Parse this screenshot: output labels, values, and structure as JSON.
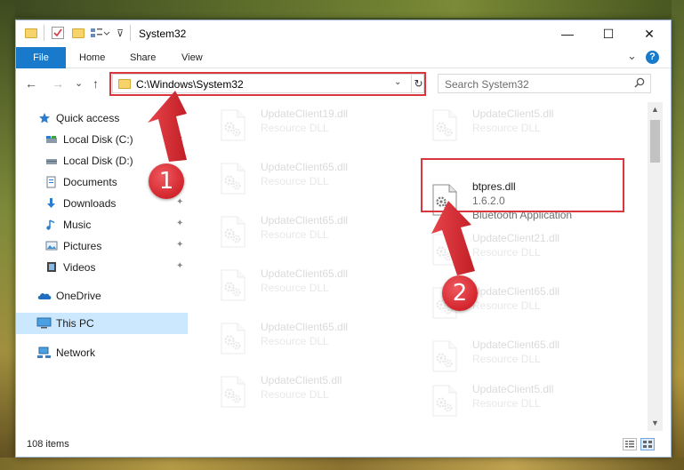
{
  "window": {
    "title": "System32",
    "min_glyph": "—",
    "max_glyph": "☐",
    "close_glyph": "✕"
  },
  "ribbon": {
    "tabs": [
      "File",
      "Home",
      "Share",
      "View"
    ],
    "expand_glyph": "⌄",
    "help_glyph": "?"
  },
  "address": {
    "path": "C:\\Windows\\System32",
    "back_glyph": "←",
    "forward_glyph": "→",
    "recent_glyph": "⌄",
    "up_glyph": "↑",
    "dropdown_glyph": "⌄",
    "refresh_glyph": "↻"
  },
  "search": {
    "placeholder": "Search System32",
    "icon": "search-icon"
  },
  "sidebar": {
    "items": [
      {
        "label": "Quick access",
        "icon": "star-icon"
      },
      {
        "label": "Local Disk (C:)",
        "icon": "drive-icon",
        "pinned": true
      },
      {
        "label": "Local Disk (D:)",
        "icon": "drive-icon",
        "pinned": true
      },
      {
        "label": "Documents",
        "icon": "documents-icon",
        "pinned": true
      },
      {
        "label": "Downloads",
        "icon": "download-icon",
        "pinned": true
      },
      {
        "label": "Music",
        "icon": "music-icon",
        "pinned": true
      },
      {
        "label": "Pictures",
        "icon": "pictures-icon",
        "pinned": true
      },
      {
        "label": "Videos",
        "icon": "videos-icon",
        "pinned": true
      },
      {
        "label": "OneDrive",
        "icon": "cloud-icon"
      },
      {
        "label": "This PC",
        "icon": "computer-icon",
        "selected": true
      },
      {
        "label": "Network",
        "icon": "network-icon"
      }
    ],
    "pin_glyph": "✦"
  },
  "files": {
    "left_column": [
      {
        "name": "UpdateClient19.dll",
        "desc": "Resource DLL"
      },
      {
        "name": "UpdateClient65.dll",
        "desc": "Resource DLL"
      },
      {
        "name": "UpdateClient65.dll",
        "desc": "Resource DLL"
      },
      {
        "name": "UpdateClient65.dll",
        "desc": "Resource DLL"
      },
      {
        "name": "UpdateClient65.dll",
        "desc": "Resource DLL"
      },
      {
        "name": "UpdateClient5.dll",
        "desc": "Resource DLL"
      }
    ],
    "right_column": [
      {
        "name": "UpdateClient5.dll",
        "desc": "Resource DLL"
      },
      {
        "name": "UpdateClient21.dll",
        "desc": "Resource DLL"
      },
      {
        "name": "UpdateClient65.dll",
        "desc": "Resource DLL"
      },
      {
        "name": "UpdateClient65.dll",
        "desc": "Resource DLL"
      },
      {
        "name": "UpdateClient5.dll",
        "desc": "Resource DLL"
      }
    ],
    "highlighted": {
      "name": "btpres.dll",
      "version": "1.6.2.0",
      "desc": "Bluetooth Application"
    }
  },
  "status": {
    "item_count": "108 items"
  },
  "callouts": {
    "one": "1",
    "two": "2"
  },
  "colors": {
    "accent": "#1979ca",
    "highlight_red": "#d9363e",
    "selected_bg": "#cce8ff"
  }
}
